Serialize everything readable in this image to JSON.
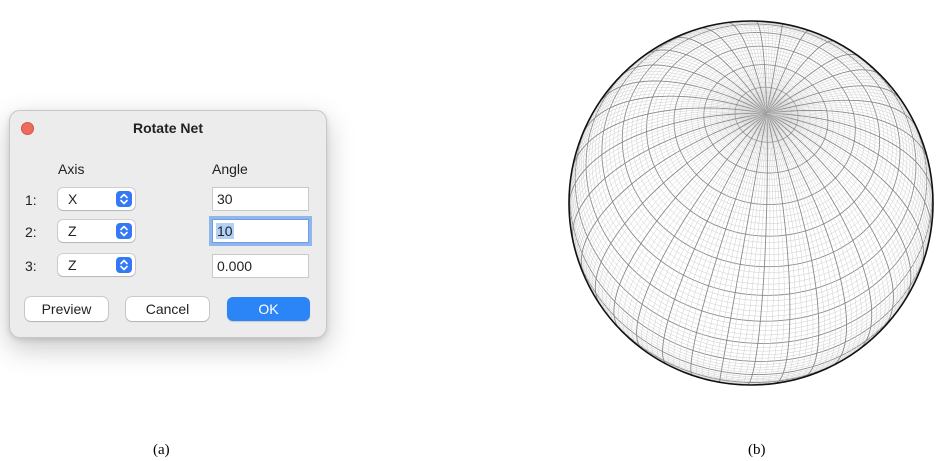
{
  "dialog": {
    "title": "Rotate Net",
    "axis_header": "Axis",
    "angle_header": "Angle",
    "rows": [
      {
        "label": "1:",
        "axis": "X",
        "angle": "30"
      },
      {
        "label": "2:",
        "axis": "Z",
        "angle": "10"
      },
      {
        "label": "3:",
        "axis": "Z",
        "angle": "0.000"
      }
    ],
    "buttons": {
      "preview": "Preview",
      "cancel": "Cancel",
      "ok": "OK"
    }
  },
  "captions": {
    "a": "(a)",
    "b": "(b)"
  },
  "colors": {
    "accent": "#2c85f6",
    "close": "#ec6a5e",
    "net_major": "#8a8a8a",
    "net_minor": "#cfcfcf"
  },
  "net": {
    "rotation_x_deg": 30,
    "rotation_z_deg": 10,
    "rotation_z2_deg": 0
  }
}
